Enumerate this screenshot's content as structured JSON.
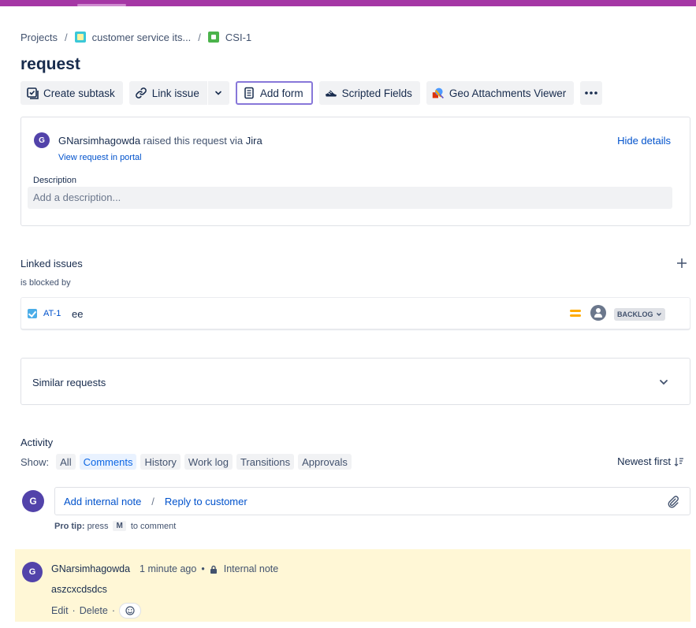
{
  "colors": {
    "top_bar": "#a537a5",
    "link": "#0052cc",
    "avatar": "#5243aa",
    "note_bg": "#fff7d6",
    "active_filter": "#e9f2ff",
    "priority": "#ffab00"
  },
  "breadcrumb": {
    "projects": "Projects",
    "project": "customer service its...",
    "issue": "CSI-1",
    "separator": "/"
  },
  "issue": {
    "title": "request"
  },
  "toolbar": {
    "create_subtask": "Create subtask",
    "link_issue": "Link issue",
    "add_form": "Add form",
    "scripted_fields": "Scripted Fields",
    "geo_attachments": "Geo Attachments Viewer"
  },
  "request": {
    "avatar_initial": "G",
    "reporter": "GNarsimhagowda",
    "raised_text": "raised this request via",
    "channel": "Jira",
    "view_portal": "View request in portal",
    "hide_details": "Hide details",
    "description_label": "Description",
    "description_placeholder": "Add a description..."
  },
  "linked": {
    "title": "Linked issues",
    "relation": "is blocked by",
    "items": [
      {
        "key": "AT-1",
        "summary": "ee",
        "status": "BACKLOG",
        "priority": "medium"
      }
    ]
  },
  "similar": {
    "title": "Similar requests"
  },
  "activity": {
    "title": "Activity",
    "show_label": "Show:",
    "filters": [
      "All",
      "Comments",
      "History",
      "Work log",
      "Transitions",
      "Approvals"
    ],
    "active_filter": "Comments",
    "sort": "Newest first"
  },
  "composer": {
    "avatar_initial": "G",
    "internal_note": "Add internal note",
    "separator": "/",
    "reply": "Reply to customer",
    "protip_bold": "Pro tip:",
    "protip_press": "press",
    "protip_key": "M",
    "protip_rest": "to comment"
  },
  "comment": {
    "avatar_initial": "G",
    "author": "GNarsimhagowda",
    "time": "1 minute ago",
    "visibility": "Internal note",
    "body": "aszcxcdsdcs",
    "edit": "Edit",
    "delete": "Delete",
    "dot": "•",
    "action_sep": "·"
  }
}
